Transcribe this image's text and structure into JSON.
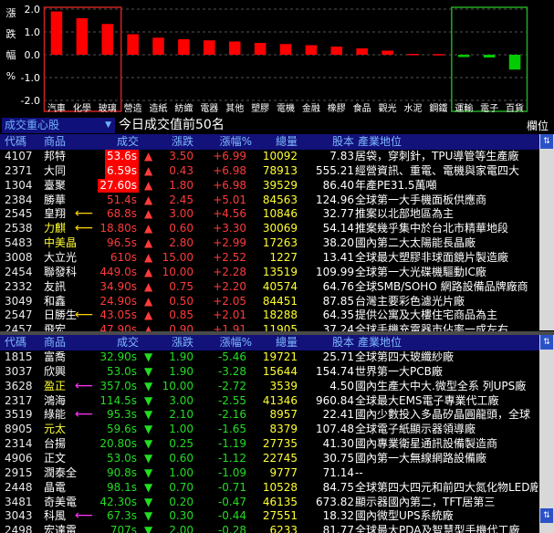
{
  "chart_data": {
    "type": "bar",
    "ylabel": "漲跌幅%",
    "ylim": [
      -2.0,
      2.0
    ],
    "yticks": [
      "2.0",
      "1.0",
      "0.0",
      "-1.0",
      "-2.0"
    ],
    "categories": [
      "汽車",
      "化學",
      "玻璃",
      "營造",
      "造紙",
      "紡織",
      "電器",
      "其他",
      "塑膠",
      "電機",
      "金融",
      "橡膠",
      "食品",
      "觀光",
      "水泥",
      "鋼鐵",
      "運輸",
      "電子",
      "百貨"
    ],
    "values": [
      1.9,
      1.6,
      1.35,
      0.9,
      0.75,
      0.68,
      0.63,
      0.58,
      0.52,
      0.47,
      0.42,
      0.36,
      0.28,
      0.18,
      0.04,
      0.03,
      -0.1,
      -0.12,
      -0.65
    ],
    "colors": {
      "up": "#ff0000",
      "down": "#00cc00"
    },
    "highlight_up_box": "#cc2222",
    "highlight_down_box": "#22aa22"
  },
  "panel": {
    "dropdown": "成交重心股",
    "dropdown_arrow": "▼",
    "title": "今日成交值前50名",
    "columns_button": "欄位"
  },
  "headers": {
    "top": [
      "代碼",
      "商品",
      "成交",
      "漲跌",
      "漲幅%",
      "總量",
      "股本",
      "產業地位"
    ],
    "bottom": [
      "代碼",
      "商品",
      "成交",
      "漲跌",
      "漲幅%",
      "總量",
      "股本",
      "產業地位"
    ]
  },
  "top_rows": [
    {
      "code": "4107",
      "name": "邦特",
      "price": "53.6s",
      "arrow": "▲",
      "chg": "3.50",
      "pct": "+6.99",
      "vol": "10092",
      "cap": "7.83",
      "ind": "居袋，穿刺針，TPU導管等生產廠",
      "hl": true,
      "mark": ""
    },
    {
      "code": "2371",
      "name": "大同",
      "price": "6.59s",
      "arrow": "▲",
      "chg": "0.43",
      "pct": "+6.98",
      "vol": "78913",
      "cap": "555.21",
      "ind": "經營資訊、重電、電機與家電四大",
      "hl": true,
      "mark": ""
    },
    {
      "code": "1304",
      "name": "臺聚",
      "price": "27.60s",
      "arrow": "▲",
      "chg": "1.80",
      "pct": "+6.98",
      "vol": "39529",
      "cap": "86.40",
      "ind": "年產PE31.5萬噸",
      "hl": true,
      "mark": ""
    },
    {
      "code": "2384",
      "name": "勝華",
      "price": "51.4s",
      "arrow": "▲",
      "chg": "2.45",
      "pct": "+5.01",
      "vol": "84563",
      "cap": "124.96",
      "ind": "全球第一大手機面板供應商",
      "hl": false,
      "mark": ""
    },
    {
      "code": "2545",
      "name": "皇翔",
      "price": "68.8s",
      "arrow": "▲",
      "chg": "3.00",
      "pct": "+4.56",
      "vol": "10846",
      "cap": "32.77",
      "ind": "推案以北部地區為主",
      "hl": false,
      "mark": "y"
    },
    {
      "code": "2538",
      "name": "力麒",
      "price": "18.80s",
      "arrow": "▲",
      "chg": "0.60",
      "pct": "+3.30",
      "vol": "30069",
      "cap": "54.14",
      "ind": "推案幾乎集中於台北市精華地段",
      "hl": false,
      "mark": "y"
    },
    {
      "code": "5483",
      "name": "中美晶",
      "price": "96.5s",
      "arrow": "▲",
      "chg": "2.80",
      "pct": "+2.99",
      "vol": "17263",
      "cap": "38.20",
      "ind": "國內第二大太陽能長晶廠",
      "hl": false,
      "mark": ""
    },
    {
      "code": "3008",
      "name": "大立光",
      "price": "610s",
      "arrow": "▲",
      "chg": "15.00",
      "pct": "+2.52",
      "vol": "1227",
      "cap": "13.41",
      "ind": "全球最大塑膠非球面鏡片製造廠",
      "hl": false,
      "mark": ""
    },
    {
      "code": "2454",
      "name": "聯發科",
      "price": "449.0s",
      "arrow": "▲",
      "chg": "10.00",
      "pct": "+2.28",
      "vol": "13519",
      "cap": "109.99",
      "ind": "全球第一大光碟機驅動IC廠",
      "hl": false,
      "mark": ""
    },
    {
      "code": "2332",
      "name": "友訊",
      "price": "34.90s",
      "arrow": "▲",
      "chg": "0.75",
      "pct": "+2.20",
      "vol": "40574",
      "cap": "64.76",
      "ind": "全球SMB/SOHO 網路設備品牌廠商",
      "hl": false,
      "mark": ""
    },
    {
      "code": "3049",
      "name": "和鑫",
      "price": "24.90s",
      "arrow": "▲",
      "chg": "0.50",
      "pct": "+2.05",
      "vol": "84451",
      "cap": "87.85",
      "ind": "台灣主要彩色濾光片廠",
      "hl": false,
      "mark": ""
    },
    {
      "code": "2547",
      "name": "日勝生",
      "price": "43.05s",
      "arrow": "▲",
      "chg": "0.85",
      "pct": "+2.01",
      "vol": "18288",
      "cap": "64.35",
      "ind": "提供公寓及大樓住宅商品為主",
      "hl": false,
      "mark": "y"
    },
    {
      "code": "2457",
      "name": "飛宏",
      "price": "47.90s",
      "arrow": "▲",
      "chg": "0.90",
      "pct": "+1.91",
      "vol": "11905",
      "cap": "37.24",
      "ind": "全球手機充電器市佔率一成左右",
      "hl": false,
      "mark": ""
    }
  ],
  "bottom_rows": [
    {
      "code": "1815",
      "name": "富喬",
      "price": "32.90s",
      "arrow": "▼",
      "chg": "1.90",
      "pct": "-5.46",
      "vol": "19721",
      "cap": "25.71",
      "ind": "全球第四大玻纖紗廠",
      "mark": ""
    },
    {
      "code": "3037",
      "name": "欣興",
      "price": "53.0s",
      "arrow": "▼",
      "chg": "1.90",
      "pct": "-3.28",
      "vol": "15644",
      "cap": "154.74",
      "ind": "世界第一大PCB廠",
      "mark": ""
    },
    {
      "code": "3628",
      "name": "盈正",
      "price": "357.0s",
      "arrow": "▼",
      "chg": "10.00",
      "pct": "-2.72",
      "vol": "3539",
      "cap": "4.50",
      "ind": "國內生產大中大.微型全系 列UPS廠",
      "mark": "m"
    },
    {
      "code": "2317",
      "name": "鴻海",
      "price": "114.5s",
      "arrow": "▼",
      "chg": "3.00",
      "pct": "-2.55",
      "vol": "41346",
      "cap": "960.84",
      "ind": "全球最大EMS電子專業代工廠",
      "mark": ""
    },
    {
      "code": "3519",
      "name": "綠能",
      "price": "95.3s",
      "arrow": "▼",
      "chg": "2.10",
      "pct": "-2.16",
      "vol": "8957",
      "cap": "22.41",
      "ind": "國內少數投入多晶矽晶圓龍頭，全球",
      "mark": "m"
    },
    {
      "code": "8905",
      "name": "元太",
      "price": "59.6s",
      "arrow": "▼",
      "chg": "1.00",
      "pct": "-1.65",
      "vol": "8379",
      "cap": "107.48",
      "ind": "全球電子紙顯示器領導廠",
      "mark": ""
    },
    {
      "code": "2314",
      "name": "台揚",
      "price": "20.80s",
      "arrow": "▼",
      "chg": "0.25",
      "pct": "-1.19",
      "vol": "27735",
      "cap": "41.30",
      "ind": "國內專業衛星通訊設備製造商",
      "mark": ""
    },
    {
      "code": "4906",
      "name": "正文",
      "price": "53.0s",
      "arrow": "▼",
      "chg": "0.60",
      "pct": "-1.12",
      "vol": "22745",
      "cap": "30.75",
      "ind": "國內第一大無線網路設備廠",
      "mark": ""
    },
    {
      "code": "2915",
      "name": "潤泰全",
      "price": "90.8s",
      "arrow": "▼",
      "chg": "1.00",
      "pct": "-1.09",
      "vol": "9777",
      "cap": "71.14",
      "ind": "--",
      "mark": ""
    },
    {
      "code": "2448",
      "name": "晶電",
      "price": "98.1s",
      "arrow": "▼",
      "chg": "0.70",
      "pct": "-0.71",
      "vol": "10528",
      "cap": "84.75",
      "ind": "全球第四大四元和前四大氮化物LED廠",
      "mark": ""
    },
    {
      "code": "3481",
      "name": "奇美電",
      "price": "42.30s",
      "arrow": "▼",
      "chg": "0.20",
      "pct": "-0.47",
      "vol": "46135",
      "cap": "673.82",
      "ind": "顯示器國內第二，TFT居第三",
      "mark": ""
    },
    {
      "code": "3043",
      "name": "科風",
      "price": "67.3s",
      "arrow": "▼",
      "chg": "0.30",
      "pct": "-0.44",
      "vol": "27551",
      "cap": "18.32",
      "ind": "國內微型UPS系統廠",
      "mark": "m"
    },
    {
      "code": "2498",
      "name": "宏達電",
      "price": "707s",
      "arrow": "▼",
      "chg": "2.00",
      "pct": "-0.28",
      "vol": "6233",
      "cap": "81.77",
      "ind": "全球最大PDA及智慧型手機代工廠",
      "mark": ""
    }
  ]
}
